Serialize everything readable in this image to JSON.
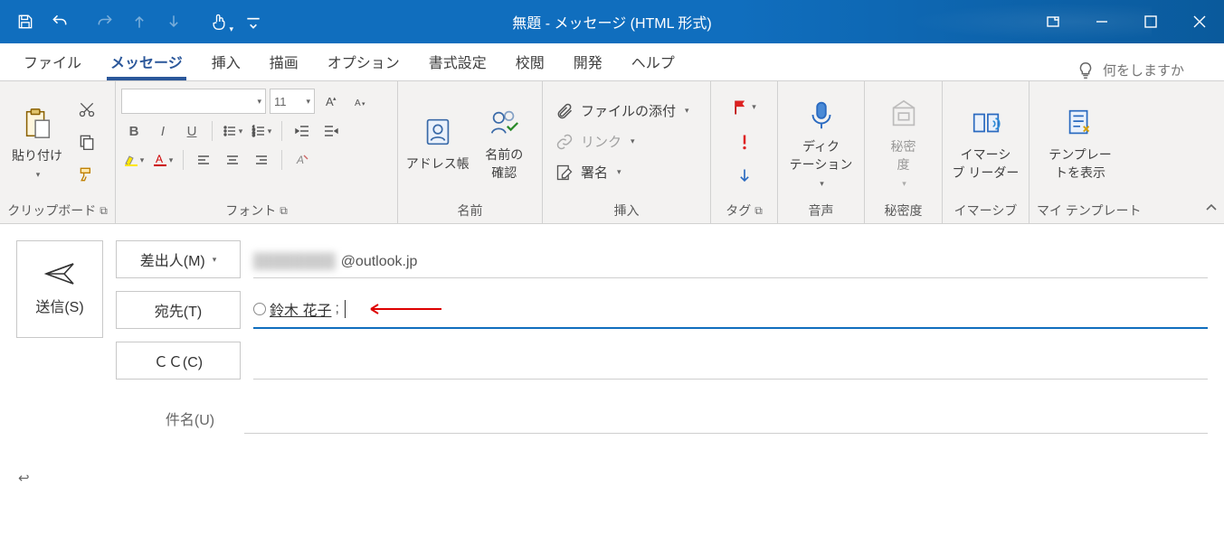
{
  "window": {
    "title": "無題  -  メッセージ (HTML 形式)"
  },
  "tabs": {
    "file": "ファイル",
    "message": "メッセージ",
    "insert": "挿入",
    "draw": "描画",
    "options": "オプション",
    "format": "書式設定",
    "review": "校閲",
    "developer": "開発",
    "help": "ヘルプ",
    "search_placeholder": "何をしますか"
  },
  "ribbon": {
    "clipboard": {
      "paste": "貼り付け",
      "label": "クリップボード"
    },
    "font": {
      "size": "11",
      "label": "フォント"
    },
    "names": {
      "address_book": "アドレス帳",
      "check_names": "名前の\n確認",
      "label": "名前"
    },
    "include": {
      "attach_file": "ファイルの添付",
      "link": "リンク",
      "signature": "署名",
      "label": "挿入"
    },
    "tags": {
      "label": "タグ"
    },
    "voice": {
      "dictate": "ディク\nテーション",
      "label": "音声"
    },
    "sensitivity": {
      "btn": "秘密\n度",
      "label": "秘密度"
    },
    "immersive": {
      "btn": "イマーシ\nブ リーダー",
      "label": "イマーシブ"
    },
    "templates": {
      "btn": "テンプレー\nトを表示",
      "label": "マイ テンプレート"
    }
  },
  "compose": {
    "send": "送信(S)",
    "from_btn": "差出人(M)",
    "from_value": "@outlook.jp",
    "to_btn": "宛先(T)",
    "to_recipient": "鈴木 花子",
    "cc_btn": "ＣＣ(C)",
    "subject_label": "件名(U)"
  }
}
